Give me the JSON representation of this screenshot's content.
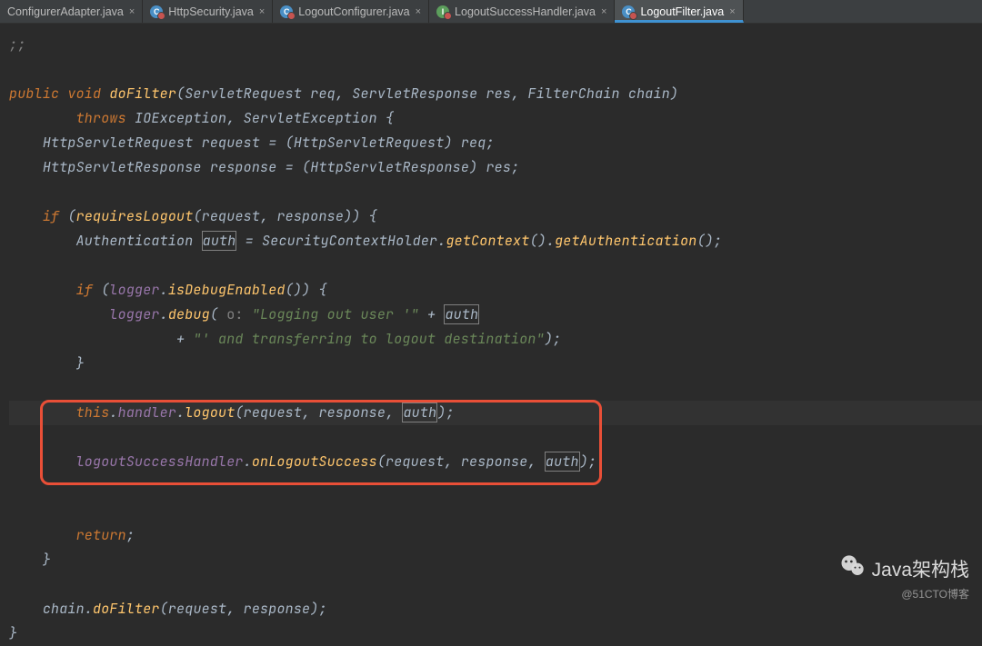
{
  "tabs": [
    {
      "label": "ConfigurerAdapter.java",
      "icon": "class",
      "active": false,
      "truncatedLeft": true
    },
    {
      "label": "HttpSecurity.java",
      "icon": "class",
      "active": false,
      "badge": true
    },
    {
      "label": "LogoutConfigurer.java",
      "icon": "class",
      "active": false,
      "badge": true
    },
    {
      "label": "LogoutSuccessHandler.java",
      "icon": "interface",
      "active": false,
      "badge": true
    },
    {
      "label": "LogoutFilter.java",
      "icon": "class",
      "active": true,
      "badge": true
    }
  ],
  "code": {
    "l0": ";;",
    "kw_public": "public",
    "kw_void": "void",
    "m_doFilter": "doFilter",
    "t_ServletRequest": "ServletRequest",
    "p_req": "req",
    "t_ServletResponse": "ServletResponse",
    "p_res": "res",
    "t_FilterChain": "FilterChain",
    "p_chain": "chain",
    "kw_throws": "throws",
    "t_IOException": "IOException",
    "t_ServletException": "ServletException",
    "t_HttpServletRequest": "HttpServletRequest",
    "v_request": "request",
    "t_HttpServletResponse": "HttpServletResponse",
    "v_response": "response",
    "kw_if": "if",
    "m_requiresLogout": "requiresLogout",
    "t_Authentication": "Authentication",
    "v_auth": "auth",
    "t_SecurityContextHolder": "SecurityContextHolder",
    "m_getContext": "getContext",
    "m_getAuthentication": "getAuthentication",
    "f_logger": "logger",
    "m_isDebugEnabled": "isDebugEnabled",
    "m_debug": "debug",
    "ptag_o": "o:",
    "s_logging1": "\"Logging out user '\"",
    "s_logging2": "\"' and transferring to logout destination\"",
    "kw_this": "this",
    "f_handler": "handler",
    "m_logout": "logout",
    "f_logoutSuccessHandler": "logoutSuccessHandler",
    "m_onLogoutSuccess": "onLogoutSuccess",
    "kw_return": "return"
  },
  "watermark": {
    "main": "Java架构栈",
    "sub": "@51CTO博客"
  }
}
